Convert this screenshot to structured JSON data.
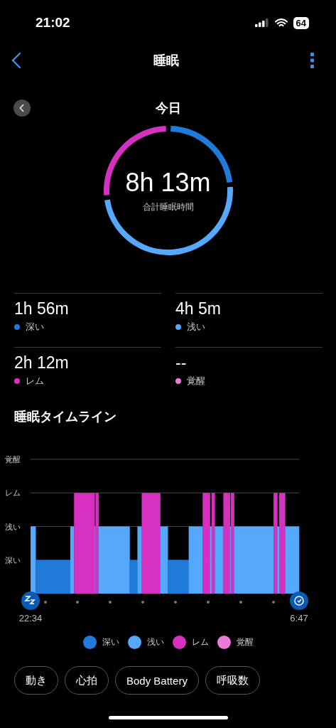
{
  "status_bar": {
    "time": "21:02",
    "battery": "64"
  },
  "header": {
    "title": "睡眠"
  },
  "date_nav": {
    "label": "今日"
  },
  "summary": {
    "total": "8h 13m",
    "caption": "合計睡眠時間"
  },
  "stats": [
    {
      "value": "1h 56m",
      "label": "深い",
      "color": "#1f7ad9"
    },
    {
      "value": "4h 5m",
      "label": "浅い",
      "color": "#56a8fb"
    },
    {
      "value": "2h 12m",
      "label": "レム",
      "color": "#d530c0"
    },
    {
      "value": "--",
      "label": "覚醒",
      "color": "#ec7ad8"
    }
  ],
  "timeline": {
    "title": "睡眠タイムライン",
    "stage_labels": [
      "覚醒",
      "レム",
      "浅い",
      "深い"
    ],
    "start_time": "22:34",
    "end_time": "6:47"
  },
  "legend": [
    {
      "label": "深い",
      "color": "#1f7ad9"
    },
    {
      "label": "浅い",
      "color": "#56a8fb"
    },
    {
      "label": "レム",
      "color": "#d530c0"
    },
    {
      "label": "覚醒",
      "color": "#ec7ad8"
    }
  ],
  "chips": [
    "動き",
    "心拍",
    "Body Battery",
    "呼吸数"
  ]
}
